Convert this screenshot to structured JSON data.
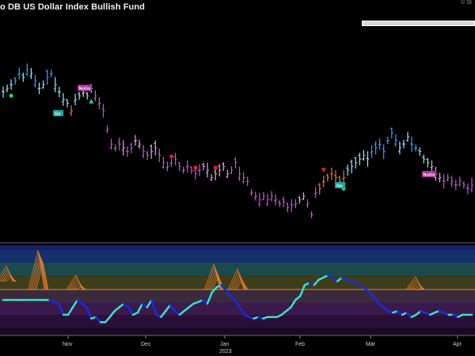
{
  "header": {
    "title": "o DB US Dollar Index Bullish Fund",
    "watermark": "© St"
  },
  "search": {
    "placeholder": ""
  },
  "labels": {
    "go_1": "Go",
    "nogo_1": "NoGo",
    "go_2": "Go",
    "nogo_2": "NoGo"
  },
  "x_axis": {
    "months": [
      "Nov",
      "Dec",
      "Jan",
      "Feb",
      "Mar",
      "Apr"
    ],
    "year": "2023"
  },
  "colors": {
    "background": "#000000",
    "strong_go": "#3aa0ff",
    "weak_go": "#9ee7ff",
    "nogo": "#c05ad6",
    "weak_nogo": "#e8a8f0",
    "transition": "#e87b2e",
    "oscillator_up": "#38e0d0",
    "oscillator_down": "#1a2be0",
    "go_label_bg": "#1aa3a3",
    "nogo_label_bg": "#a8319c"
  },
  "chart_data": {
    "type": "line",
    "title": "o DB US Dollar Index Bullish Fund",
    "xlabel": "",
    "ylabel": "",
    "x_ticks": [
      "Nov",
      "Dec",
      "2023",
      "Jan",
      "Feb",
      "Mar",
      "Apr"
    ],
    "grid": false,
    "price_series": [
      {
        "i": 0,
        "close": 0.76,
        "c": "weak_go"
      },
      {
        "i": 1,
        "close": 0.78,
        "c": "weak_go"
      },
      {
        "i": 2,
        "close": 0.8,
        "c": "weak_go"
      },
      {
        "i": 3,
        "close": 0.82,
        "c": "strong_go"
      },
      {
        "i": 4,
        "close": 0.86,
        "c": "strong_go"
      },
      {
        "i": 5,
        "close": 0.84,
        "c": "weak_go"
      },
      {
        "i": 6,
        "close": 0.88,
        "c": "strong_go"
      },
      {
        "i": 7,
        "close": 0.86,
        "c": "weak_go"
      },
      {
        "i": 8,
        "close": 0.82,
        "c": "strong_go"
      },
      {
        "i": 9,
        "close": 0.78,
        "c": "weak_go"
      },
      {
        "i": 10,
        "close": 0.8,
        "c": "weak_go"
      },
      {
        "i": 11,
        "close": 0.84,
        "c": "strong_go"
      },
      {
        "i": 12,
        "close": 0.86,
        "c": "strong_go"
      },
      {
        "i": 13,
        "close": 0.8,
        "c": "weak_go"
      },
      {
        "i": 14,
        "close": 0.76,
        "c": "weak_go"
      },
      {
        "i": 15,
        "close": 0.72,
        "c": "weak_go"
      },
      {
        "i": 16,
        "close": 0.7,
        "c": "weak_go"
      },
      {
        "i": 17,
        "close": 0.66,
        "c": "transition"
      },
      {
        "i": 18,
        "close": 0.72,
        "c": "weak_go"
      },
      {
        "i": 19,
        "close": 0.74,
        "c": "weak_go"
      },
      {
        "i": 20,
        "close": 0.76,
        "c": "weak_go"
      },
      {
        "i": 21,
        "close": 0.74,
        "c": "weak_go"
      },
      {
        "i": 22,
        "close": 0.78,
        "c": "weak_go"
      },
      {
        "i": 23,
        "close": 0.74,
        "c": "nogo"
      },
      {
        "i": 24,
        "close": 0.7,
        "c": "nogo"
      },
      {
        "i": 25,
        "close": 0.66,
        "c": "nogo"
      },
      {
        "i": 26,
        "close": 0.56,
        "c": "nogo"
      },
      {
        "i": 27,
        "close": 0.48,
        "c": "nogo"
      },
      {
        "i": 28,
        "close": 0.46,
        "c": "nogo"
      },
      {
        "i": 29,
        "close": 0.48,
        "c": "nogo"
      },
      {
        "i": 30,
        "close": 0.46,
        "c": "weak_nogo"
      },
      {
        "i": 31,
        "close": 0.44,
        "c": "nogo"
      },
      {
        "i": 32,
        "close": 0.46,
        "c": "nogo"
      },
      {
        "i": 33,
        "close": 0.5,
        "c": "weak_nogo"
      },
      {
        "i": 34,
        "close": 0.48,
        "c": "weak_nogo"
      },
      {
        "i": 35,
        "close": 0.44,
        "c": "nogo"
      },
      {
        "i": 36,
        "close": 0.42,
        "c": "nogo"
      },
      {
        "i": 37,
        "close": 0.44,
        "c": "weak_nogo"
      },
      {
        "i": 38,
        "close": 0.46,
        "c": "weak_nogo"
      },
      {
        "i": 39,
        "close": 0.42,
        "c": "nogo"
      },
      {
        "i": 40,
        "close": 0.38,
        "c": "nogo"
      },
      {
        "i": 41,
        "close": 0.36,
        "c": "nogo"
      },
      {
        "i": 42,
        "close": 0.38,
        "c": "nogo"
      },
      {
        "i": 43,
        "close": 0.4,
        "c": "nogo"
      },
      {
        "i": 44,
        "close": 0.36,
        "c": "nogo"
      },
      {
        "i": 45,
        "close": 0.34,
        "c": "nogo"
      },
      {
        "i": 46,
        "close": 0.36,
        "c": "nogo"
      },
      {
        "i": 47,
        "close": 0.34,
        "c": "nogo"
      },
      {
        "i": 48,
        "close": 0.32,
        "c": "nogo"
      },
      {
        "i": 49,
        "close": 0.34,
        "c": "nogo"
      },
      {
        "i": 50,
        "close": 0.36,
        "c": "weak_nogo"
      },
      {
        "i": 51,
        "close": 0.34,
        "c": "weak_nogo"
      },
      {
        "i": 52,
        "close": 0.3,
        "c": "weak_nogo"
      },
      {
        "i": 53,
        "close": 0.32,
        "c": "weak_nogo"
      },
      {
        "i": 54,
        "close": 0.34,
        "c": "weak_nogo"
      },
      {
        "i": 55,
        "close": 0.36,
        "c": "weak_nogo"
      },
      {
        "i": 56,
        "close": 0.32,
        "c": "weak_nogo"
      },
      {
        "i": 57,
        "close": 0.34,
        "c": "nogo"
      },
      {
        "i": 58,
        "close": 0.38,
        "c": "nogo"
      },
      {
        "i": 59,
        "close": 0.32,
        "c": "nogo"
      },
      {
        "i": 60,
        "close": 0.3,
        "c": "nogo"
      },
      {
        "i": 61,
        "close": 0.28,
        "c": "nogo"
      },
      {
        "i": 62,
        "close": 0.22,
        "c": "nogo"
      },
      {
        "i": 63,
        "close": 0.2,
        "c": "nogo"
      },
      {
        "i": 64,
        "close": 0.18,
        "c": "nogo"
      },
      {
        "i": 65,
        "close": 0.2,
        "c": "nogo"
      },
      {
        "i": 66,
        "close": 0.18,
        "c": "nogo"
      },
      {
        "i": 67,
        "close": 0.2,
        "c": "nogo"
      },
      {
        "i": 68,
        "close": 0.18,
        "c": "nogo"
      },
      {
        "i": 69,
        "close": 0.16,
        "c": "nogo"
      },
      {
        "i": 70,
        "close": 0.17,
        "c": "nogo"
      },
      {
        "i": 71,
        "close": 0.14,
        "c": "nogo"
      },
      {
        "i": 72,
        "close": 0.15,
        "c": "nogo"
      },
      {
        "i": 73,
        "close": 0.16,
        "c": "nogo"
      },
      {
        "i": 74,
        "close": 0.18,
        "c": "weak_nogo"
      },
      {
        "i": 75,
        "close": 0.2,
        "c": "weak_nogo"
      },
      {
        "i": 76,
        "close": 0.16,
        "c": "nogo"
      },
      {
        "i": 77,
        "close": 0.1,
        "c": "nogo"
      },
      {
        "i": 78,
        "close": 0.22,
        "c": "nogo"
      },
      {
        "i": 79,
        "close": 0.24,
        "c": "transition"
      },
      {
        "i": 80,
        "close": 0.28,
        "c": "transition"
      },
      {
        "i": 81,
        "close": 0.3,
        "c": "transition"
      },
      {
        "i": 82,
        "close": 0.32,
        "c": "transition"
      },
      {
        "i": 83,
        "close": 0.3,
        "c": "transition"
      },
      {
        "i": 84,
        "close": 0.28,
        "c": "transition"
      },
      {
        "i": 85,
        "close": 0.3,
        "c": "transition"
      },
      {
        "i": 86,
        "close": 0.34,
        "c": "weak_go"
      },
      {
        "i": 87,
        "close": 0.36,
        "c": "weak_go"
      },
      {
        "i": 88,
        "close": 0.38,
        "c": "weak_go"
      },
      {
        "i": 89,
        "close": 0.4,
        "c": "weak_go"
      },
      {
        "i": 90,
        "close": 0.42,
        "c": "weak_go"
      },
      {
        "i": 91,
        "close": 0.4,
        "c": "weak_go"
      },
      {
        "i": 92,
        "close": 0.44,
        "c": "strong_go"
      },
      {
        "i": 93,
        "close": 0.46,
        "c": "strong_go"
      },
      {
        "i": 94,
        "close": 0.48,
        "c": "strong_go"
      },
      {
        "i": 95,
        "close": 0.44,
        "c": "strong_go"
      },
      {
        "i": 96,
        "close": 0.5,
        "c": "strong_go"
      },
      {
        "i": 97,
        "close": 0.54,
        "c": "strong_go"
      },
      {
        "i": 98,
        "close": 0.5,
        "c": "strong_go"
      },
      {
        "i": 99,
        "close": 0.46,
        "c": "weak_go"
      },
      {
        "i": 100,
        "close": 0.48,
        "c": "weak_go"
      },
      {
        "i": 101,
        "close": 0.52,
        "c": "weak_go"
      },
      {
        "i": 102,
        "close": 0.48,
        "c": "strong_go"
      },
      {
        "i": 103,
        "close": 0.46,
        "c": "strong_go"
      },
      {
        "i": 104,
        "close": 0.44,
        "c": "weak_go"
      },
      {
        "i": 105,
        "close": 0.4,
        "c": "weak_go"
      },
      {
        "i": 106,
        "close": 0.38,
        "c": "weak_go"
      },
      {
        "i": 107,
        "close": 0.36,
        "c": "weak_nogo"
      },
      {
        "i": 108,
        "close": 0.32,
        "c": "weak_nogo"
      },
      {
        "i": 109,
        "close": 0.3,
        "c": "weak_nogo"
      },
      {
        "i": 110,
        "close": 0.28,
        "c": "nogo"
      },
      {
        "i": 111,
        "close": 0.3,
        "c": "nogo"
      },
      {
        "i": 112,
        "close": 0.28,
        "c": "nogo"
      },
      {
        "i": 113,
        "close": 0.26,
        "c": "nogo"
      },
      {
        "i": 114,
        "close": 0.28,
        "c": "nogo"
      },
      {
        "i": 115,
        "close": 0.26,
        "c": "nogo"
      },
      {
        "i": 116,
        "close": 0.24,
        "c": "nogo"
      },
      {
        "i": 117,
        "close": 0.26,
        "c": "nogo"
      }
    ],
    "oscillator": [
      0.35,
      0.35,
      0.35,
      0.35,
      0.35,
      0.35,
      0.35,
      0.35,
      0.35,
      0.35,
      0.35,
      0.32,
      0.3,
      0.15,
      0.15,
      0.25,
      0.35,
      0.3,
      0.25,
      0.1,
      0.12,
      0.05,
      0.05,
      0.12,
      0.2,
      0.25,
      0.3,
      0.25,
      0.15,
      0.18,
      0.3,
      0.25,
      0.35,
      0.15,
      0.12,
      0.2,
      0.28,
      0.2,
      0.15,
      0.2,
      0.25,
      0.3,
      0.32,
      0.35,
      0.3,
      0.45,
      0.52,
      0.55,
      0.48,
      0.4,
      0.35,
      0.25,
      0.15,
      0.12,
      0.1,
      0.12,
      0.1,
      0.12,
      0.12,
      0.12,
      0.15,
      0.2,
      0.25,
      0.35,
      0.4,
      0.55,
      0.58,
      0.55,
      0.62,
      0.65,
      0.68,
      0.65,
      0.6,
      0.65,
      0.62,
      0.6,
      0.58,
      0.55,
      0.5,
      0.45,
      0.38,
      0.3,
      0.25,
      0.2,
      0.18,
      0.2,
      0.15,
      0.18,
      0.12,
      0.15,
      0.2,
      0.18,
      0.15,
      0.18,
      0.2,
      0.18,
      0.15,
      0.15,
      0.12,
      0.15,
      0.15,
      0.15
    ],
    "signals": [
      {
        "i": 2,
        "type": "dot",
        "color": "#26d07c"
      },
      {
        "i": 22,
        "type": "triangle_up",
        "color": "#26d07c"
      },
      {
        "i": 42,
        "type": "dot",
        "color": "#e0202a"
      },
      {
        "i": 48,
        "type": "dot",
        "color": "#e0202a"
      },
      {
        "i": 53,
        "type": "dot",
        "color": "#e0202a"
      },
      {
        "i": 80,
        "type": "triangle_down",
        "color": "#e0202a"
      },
      {
        "i": 85,
        "type": "dot",
        "color": "#26d07c"
      }
    ]
  }
}
